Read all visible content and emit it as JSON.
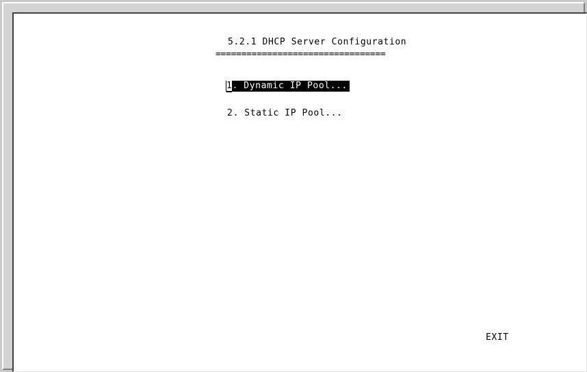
{
  "screen": {
    "title": "5.2.1 DHCP Server Configuration",
    "underline": "=================================",
    "menu_items": [
      {
        "number": "1",
        "label": ". Dynamic IP Pool...",
        "selected": true
      },
      {
        "number": "2",
        "label": ". Static IP Pool...",
        "selected": false
      }
    ],
    "exit_label": "EXIT"
  }
}
